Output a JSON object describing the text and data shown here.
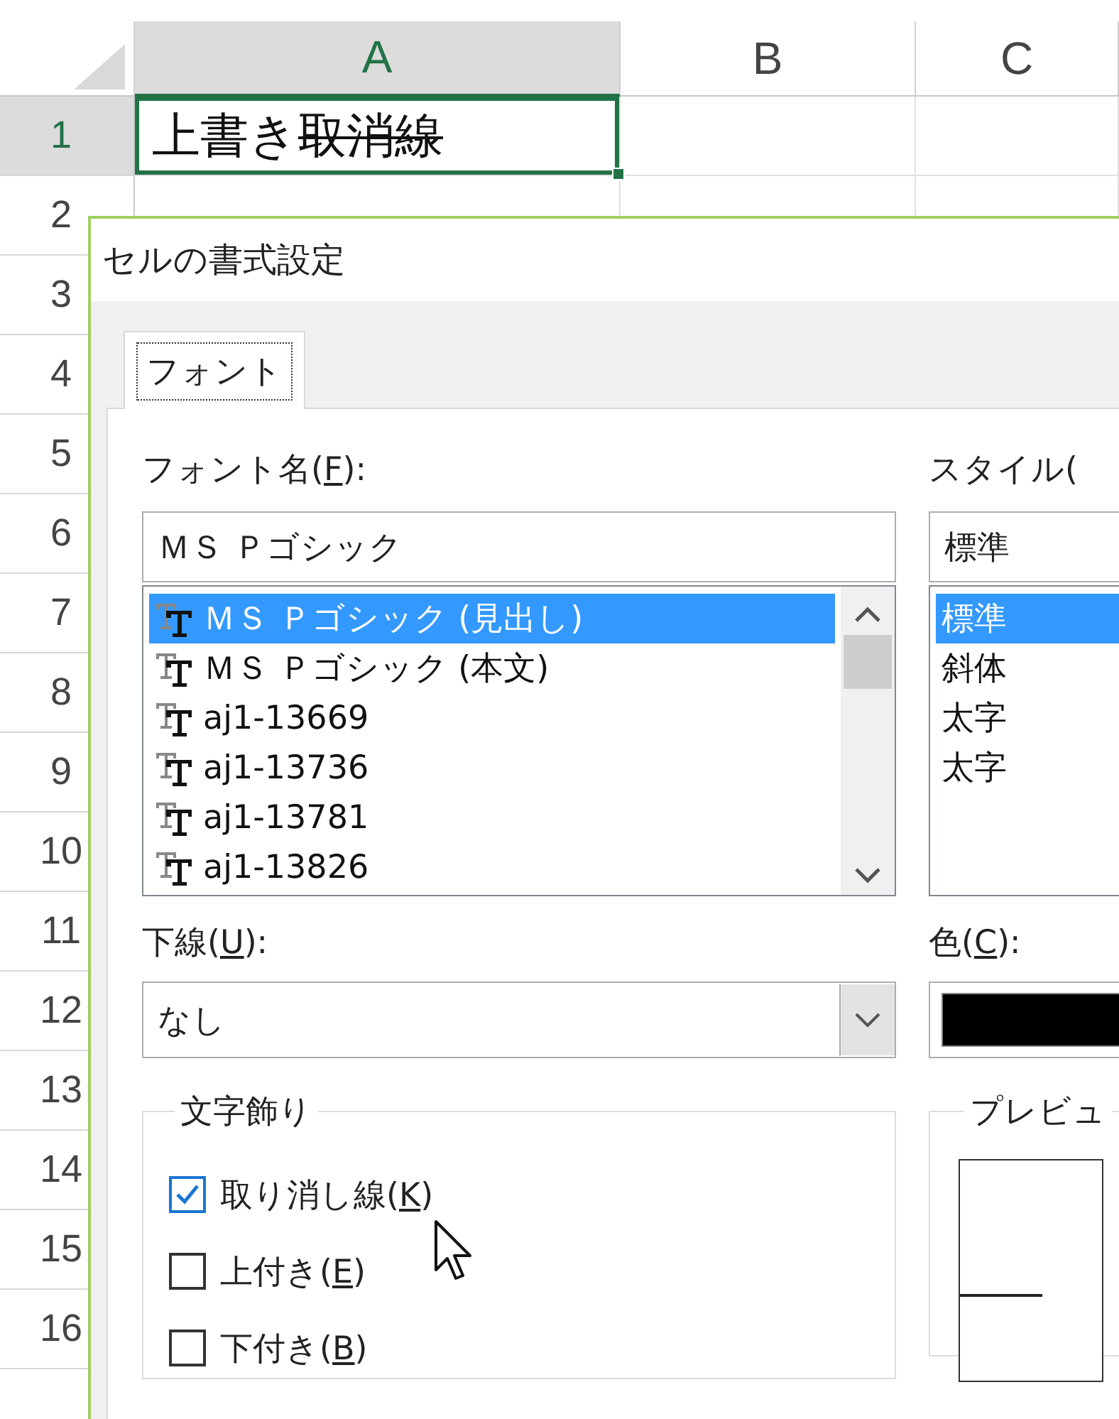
{
  "sheet": {
    "columns": [
      {
        "label": "A",
        "selected": true
      },
      {
        "label": "B",
        "selected": false
      },
      {
        "label": "C",
        "selected": false
      }
    ],
    "rows": [
      {
        "label": "1",
        "selected": true
      },
      {
        "label": "2",
        "selected": false
      },
      {
        "label": "3",
        "selected": false
      },
      {
        "label": "4",
        "selected": false
      },
      {
        "label": "5",
        "selected": false
      },
      {
        "label": "6",
        "selected": false
      },
      {
        "label": "7",
        "selected": false
      },
      {
        "label": "8",
        "selected": false
      },
      {
        "label": "9",
        "selected": false
      },
      {
        "label": "10",
        "selected": false
      },
      {
        "label": "11",
        "selected": false
      },
      {
        "label": "12",
        "selected": false
      },
      {
        "label": "13",
        "selected": false
      },
      {
        "label": "14",
        "selected": false
      },
      {
        "label": "15",
        "selected": false
      },
      {
        "label": "16",
        "selected": false
      }
    ],
    "cell_a1": {
      "selected": true,
      "segments": [
        {
          "text": "上書き",
          "strikethrough": false
        },
        {
          "text": "取消線",
          "strikethrough": true
        }
      ]
    }
  },
  "dialog": {
    "title": "セルの書式設定",
    "tabs": [
      {
        "label": "フォント",
        "selected": true
      }
    ],
    "font": {
      "label": [
        "フォント名(",
        "F",
        "):"
      ],
      "value": "ＭＳ Ｐゴシック",
      "items": [
        {
          "label": "ＭＳ Ｐゴシック (見出し)",
          "selected": true
        },
        {
          "label": "ＭＳ Ｐゴシック (本文)",
          "selected": false
        },
        {
          "label": "aj1-13669",
          "selected": false
        },
        {
          "label": "aj1-13736",
          "selected": false
        },
        {
          "label": "aj1-13781",
          "selected": false
        },
        {
          "label": "aj1-13826",
          "selected": false
        }
      ]
    },
    "style": {
      "label": [
        "スタイル("
      ],
      "value": "標準",
      "items": [
        {
          "label": "標準",
          "selected": true
        },
        {
          "label": "斜体",
          "selected": false
        },
        {
          "label": "太字",
          "selected": false
        },
        {
          "label": "太字",
          "selected": false
        }
      ]
    },
    "underline": {
      "label": [
        "下線(",
        "U",
        "):"
      ],
      "value": "なし"
    },
    "color": {
      "label": [
        "色(",
        "C",
        "):"
      ],
      "color": "#000000"
    },
    "effects": {
      "title": "文字飾り",
      "options": [
        {
          "label": [
            "取り消し線(",
            "K",
            ")"
          ],
          "checked": true
        },
        {
          "label": [
            "上付き(",
            "E",
            ")"
          ],
          "checked": false
        },
        {
          "label": [
            "下付き(",
            "B",
            ")"
          ],
          "checked": false
        }
      ]
    },
    "preview": {
      "title": "プレビュ"
    }
  }
}
